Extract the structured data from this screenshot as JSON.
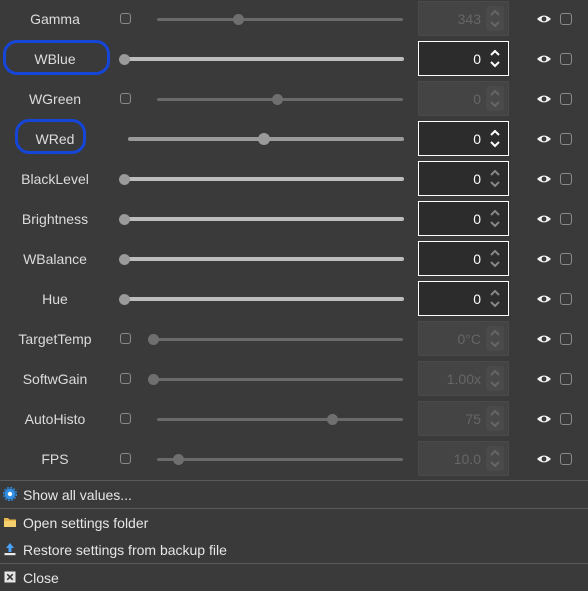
{
  "rows": [
    {
      "label": "Gamma",
      "value": "343"
    },
    {
      "label": "WBlue",
      "value": "0"
    },
    {
      "label": "WGreen",
      "value": "0"
    },
    {
      "label": "WRed",
      "value": "0"
    },
    {
      "label": "BlackLevel",
      "value": "0"
    },
    {
      "label": "Brightness",
      "value": "0"
    },
    {
      "label": "WBalance",
      "value": "0"
    },
    {
      "label": "Hue",
      "value": "0"
    },
    {
      "label": "TargetTemp",
      "value": "0°C"
    },
    {
      "label": "SoftwGain",
      "value": "1.00x"
    },
    {
      "label": "AutoHisto",
      "value": "75"
    },
    {
      "label": "FPS",
      "value": "10.0"
    }
  ],
  "menu": {
    "show_all": "Show all values...",
    "open_folder": "Open settings folder",
    "restore": "Restore settings from backup file",
    "close": "Close"
  },
  "colors": {
    "background": "#3a3a3a",
    "highlight_ring": "#1546d8",
    "text": "#dcdcdc"
  },
  "icons": [
    "eye-icon",
    "gear-icon",
    "folder-icon",
    "upload-icon",
    "close-icon",
    "chevron-up-icon",
    "chevron-down-icon"
  ]
}
